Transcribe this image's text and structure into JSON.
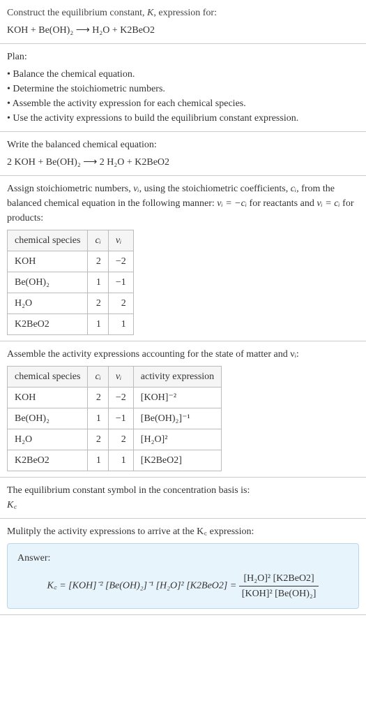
{
  "intro": {
    "line1": "Construct the equilibrium constant, ",
    "k": "K",
    "line1b": ", expression for:",
    "equation": "KOH + Be(OH)₂ ⟶ H₂O + K2BeO2"
  },
  "plan": {
    "header": "Plan:",
    "items": [
      "Balance the chemical equation.",
      "Determine the stoichiometric numbers.",
      "Assemble the activity expression for each chemical species.",
      "Use the activity expressions to build the equilibrium constant expression."
    ]
  },
  "balanced": {
    "header": "Write the balanced chemical equation:",
    "equation": "2 KOH + Be(OH)₂ ⟶ 2 H₂O + K2BeO2"
  },
  "stoich": {
    "text1": "Assign stoichiometric numbers, ",
    "vi": "νᵢ",
    "text2": ", using the stoichiometric coefficients, ",
    "ci": "cᵢ",
    "text3": ", from the balanced chemical equation in the following manner: ",
    "rel1": "νᵢ = −cᵢ",
    "text4": " for reactants and ",
    "rel2": "νᵢ = cᵢ",
    "text5": " for products:",
    "headers": [
      "chemical species",
      "cᵢ",
      "νᵢ"
    ],
    "rows": [
      [
        "KOH",
        "2",
        "−2"
      ],
      [
        "Be(OH)₂",
        "1",
        "−1"
      ],
      [
        "H₂O",
        "2",
        "2"
      ],
      [
        "K2BeO2",
        "1",
        "1"
      ]
    ]
  },
  "activity": {
    "header": "Assemble the activity expressions accounting for the state of matter and νᵢ:",
    "headers": [
      "chemical species",
      "cᵢ",
      "νᵢ",
      "activity expression"
    ],
    "rows": [
      [
        "KOH",
        "2",
        "−2",
        "[KOH]⁻²"
      ],
      [
        "Be(OH)₂",
        "1",
        "−1",
        "[Be(OH)₂]⁻¹"
      ],
      [
        "H₂O",
        "2",
        "2",
        "[H₂O]²"
      ],
      [
        "K2BeO2",
        "1",
        "1",
        "[K2BeO2]"
      ]
    ]
  },
  "symbol": {
    "header": "The equilibrium constant symbol in the concentration basis is:",
    "value": "K꜀"
  },
  "multiply": {
    "header": "Mulitply the activity expressions to arrive at the K꜀ expression:"
  },
  "answer": {
    "label": "Answer:",
    "lhs": "K꜀ = [KOH]⁻² [Be(OH)₂]⁻¹ [H₂O]² [K2BeO2] = ",
    "num": "[H₂O]² [K2BeO2]",
    "den": "[KOH]² [Be(OH)₂]"
  }
}
